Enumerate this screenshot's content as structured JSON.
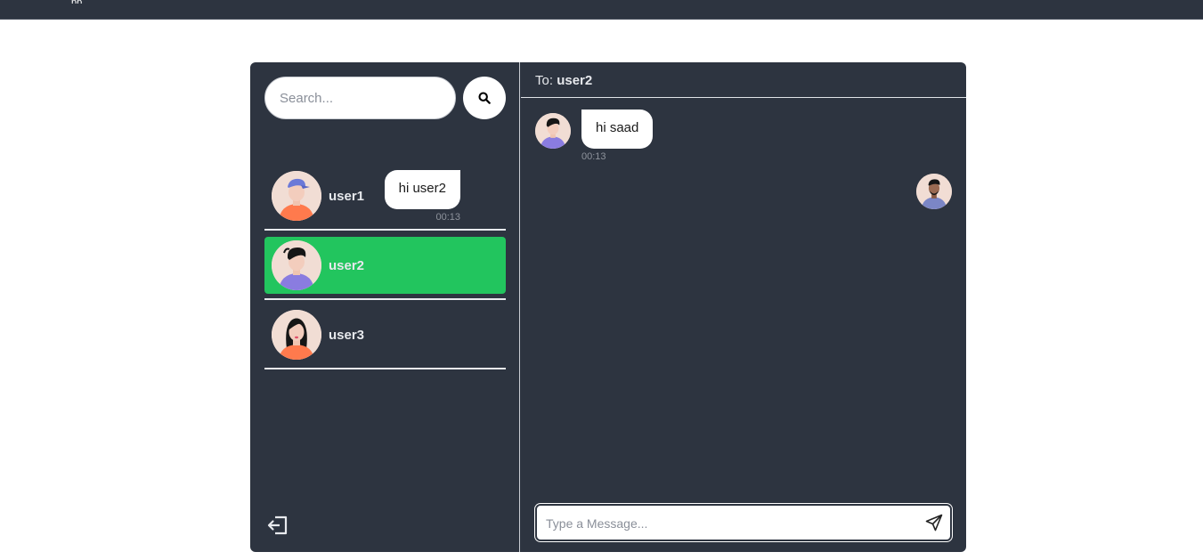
{
  "search": {
    "placeholder": "Search..."
  },
  "users": [
    {
      "name": "user1",
      "active": false
    },
    {
      "name": "user2",
      "active": true
    },
    {
      "name": "user3",
      "active": false
    }
  ],
  "chat": {
    "to_label": "To:",
    "recipient": "user2",
    "messages": [
      {
        "direction": "incoming",
        "text": "hi saad",
        "time": "00:13"
      },
      {
        "direction": "outgoing",
        "text": "hi user2",
        "time": "00:13"
      }
    ],
    "composer_placeholder": "Type a Message..."
  },
  "icons": {
    "search": "search-icon",
    "logout": "logout-icon",
    "send": "send-icon"
  },
  "colors": {
    "panel": "#2d3440",
    "active_user": "#22c55e",
    "bubble": "#ffffff"
  }
}
